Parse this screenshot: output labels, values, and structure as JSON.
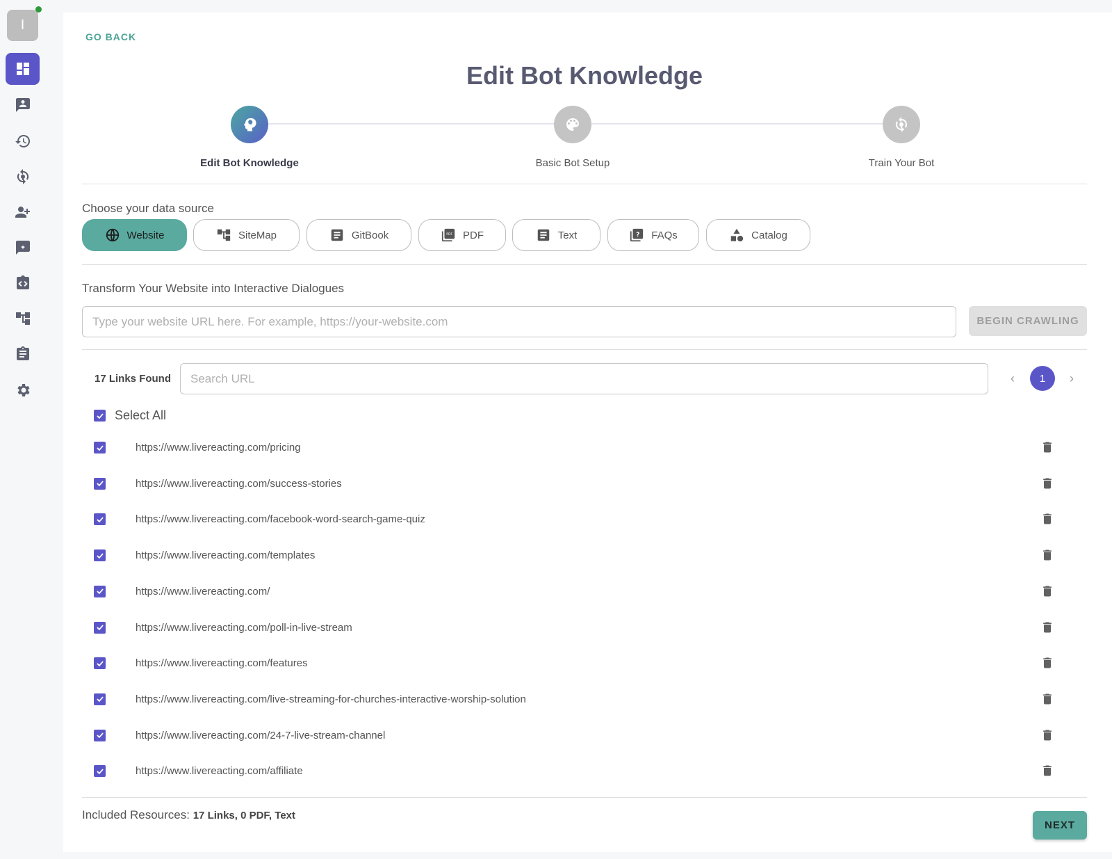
{
  "sidebar": {
    "avatar_initial": "I",
    "items": [
      "dashboard-icon",
      "chat-user-icon",
      "history-icon",
      "train-icon",
      "add-user-icon",
      "feedback-icon",
      "code-icon",
      "sitemap-icon",
      "clipboard-icon",
      "gear-icon"
    ]
  },
  "header": {
    "go_back": "GO BACK",
    "title": "Edit Bot Knowledge"
  },
  "steps": [
    {
      "label": "Edit Bot Knowledge",
      "icon": "brain-icon",
      "active": true
    },
    {
      "label": "Basic Bot Setup",
      "icon": "palette-icon",
      "active": false
    },
    {
      "label": "Train Your Bot",
      "icon": "train-icon",
      "active": false
    }
  ],
  "data_source": {
    "label": "Choose your data source",
    "options": [
      "Website",
      "SiteMap",
      "GitBook",
      "PDF",
      "Text",
      "FAQs",
      "Catalog"
    ],
    "selected": "Website"
  },
  "website": {
    "heading": "Transform Your Website into Interactive Dialogues",
    "url_placeholder": "Type your website URL here. For example, https://your-website.com",
    "crawl_button": "BEGIN CRAWLING"
  },
  "links": {
    "found_label": "17 Links Found",
    "search_placeholder": "Search URL",
    "page": "1",
    "select_all": "Select All",
    "items": [
      "https://www.livereacting.com/pricing",
      "https://www.livereacting.com/success-stories",
      "https://www.livereacting.com/facebook-word-search-game-quiz",
      "https://www.livereacting.com/templates",
      "https://www.livereacting.com/",
      "https://www.livereacting.com/poll-in-live-stream",
      "https://www.livereacting.com/features",
      "https://www.livereacting.com/live-streaming-for-churches-interactive-worship-solution",
      "https://www.livereacting.com/24-7-live-stream-channel",
      "https://www.livereacting.com/affiliate"
    ]
  },
  "footer": {
    "resources_label": "Included Resources:",
    "resources_value": "17 Links, 0 PDF, Text",
    "next_button": "NEXT"
  },
  "colors": {
    "accent": "#5b56c8",
    "teal": "#5aaa9f"
  }
}
